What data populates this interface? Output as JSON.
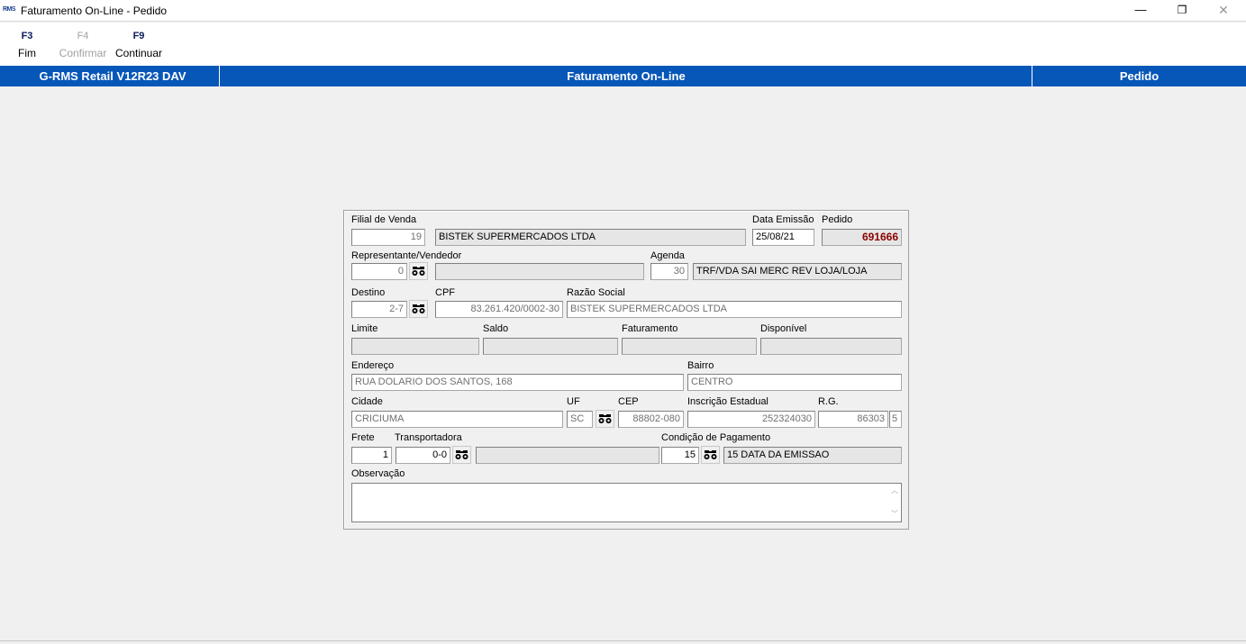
{
  "window": {
    "icon_text": "RMS",
    "title": "Faturamento On-Line - Pedido",
    "minimize": "—",
    "maximize": "❐",
    "close": "✕"
  },
  "toolbar": [
    {
      "key": "F3",
      "label": "Fim",
      "enabled": true
    },
    {
      "key": "F4",
      "label": "Confirmar",
      "enabled": false
    },
    {
      "key": "F9",
      "label": "Continuar",
      "enabled": true
    }
  ],
  "header": {
    "left": "G-RMS Retail V12R23 DAV",
    "center": "Faturamento On-Line",
    "right": "Pedido"
  },
  "form": {
    "filial_label": "Filial de Venda",
    "filial_code": "19",
    "filial_name": "BISTEK SUPERMERCADOS LTDA",
    "data_emissao_label": "Data Emissão",
    "data_emissao": "25/08/21",
    "pedido_label": "Pedido",
    "pedido": "691666",
    "representante_label": "Representante/Vendedor",
    "representante_code": "0",
    "representante_name": "",
    "agenda_label": "Agenda",
    "agenda_code": "30",
    "agenda_desc": "TRF/VDA SAI MERC REV LOJA/LOJA",
    "destino_label": "Destino",
    "destino": "2-7",
    "cpf_label": "CPF",
    "cpf": "83.261.420/0002-30",
    "razao_label": "Razão Social",
    "razao": "BISTEK SUPERMERCADOS LTDA",
    "limite_label": "Limite",
    "limite": "",
    "saldo_label": "Saldo",
    "saldo": "",
    "faturamento_label": "Faturamento",
    "faturamento": "",
    "disponivel_label": "Disponível",
    "disponivel": "",
    "endereco_label": "Endereço",
    "endereco": "RUA DOLARIO DOS SANTOS,  168",
    "bairro_label": "Bairro",
    "bairro": "CENTRO",
    "cidade_label": "Cidade",
    "cidade": "CRICIUMA",
    "uf_label": "UF",
    "uf": "SC",
    "cep_label": "CEP",
    "cep": "88802-080",
    "ie_label": "Inscrição Estadual",
    "ie": "252324030",
    "rg_label": "R.G.",
    "rg": "86303",
    "rg_digit": "5",
    "frete_label": "Frete",
    "frete": "1",
    "transportadora_label": "Transportadora",
    "transportadora_code": "0-0",
    "transportadora_name": "",
    "condicao_label": "Condição de Pagamento",
    "condicao_code": "15",
    "condicao_desc": "15 DATA DA EMISSAO",
    "observacao_label": "Observação",
    "observacao": "",
    "scroll_up": "︿",
    "scroll_down": "﹀"
  }
}
